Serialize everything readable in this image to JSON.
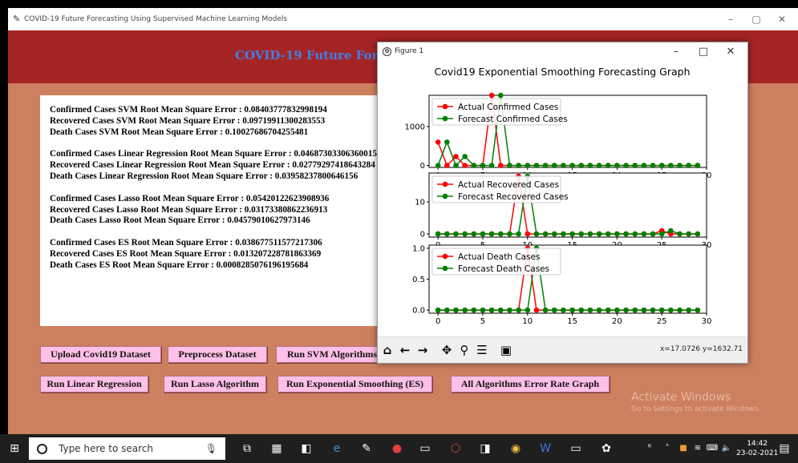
{
  "app": {
    "window_title": "COVID-19 Future Forecasting Using Supervised Machine Learning Models",
    "banner_title": "COVID-19 Future Forecasting Using Supervised Machine Learning Models",
    "window_controls": [
      "–",
      "▢",
      "✕"
    ]
  },
  "results": [
    [
      "Confirmed Cases SVM Root Mean Square Error : 0.08403777832998194",
      "Recovered Cases SVM Root Mean Square Error : 0.09719911300283553",
      "Death Cases SVM Root Mean Square Error : 0.10027686704255481"
    ],
    [
      "Confirmed Cases Linear Regression Root Mean Square Error : 0.04687303306360015",
      "Recovered Cases Linear Regression Root Mean Square Error : 0.02779297418643284",
      "Death Cases Linear Regression Root Mean Square Error : 0.03958237800646156"
    ],
    [
      "Confirmed Cases Lasso Root Mean Square Error : 0.05420122623908936",
      "Recovered Cases Lasso Root Mean Square Error : 0.03173380862236913",
      "Death Cases Lasso Root Mean Square Error : 0.04579010627973146"
    ],
    [
      "Confirmed Cases ES Root Mean Square Error : 0.038677511577217306",
      "Recovered Cases ES Root Mean Square Error : 0.013207228781863369",
      "Death Cases ES Root Mean Square Error : 0.0008285076196195684"
    ]
  ],
  "buttons": {
    "upload": "Upload Covid19 Dataset",
    "preprocess": "Preprocess Dataset",
    "svm": "Run SVM Algorithms",
    "linear": "Run Linear Regression",
    "lasso": "Run Lasso Algorithm",
    "es": "Run Exponential Smoothing (ES)",
    "error_graph": "All Algorithms Error Rate Graph"
  },
  "watermark": {
    "line1": "Activate Windows",
    "line2": "Go to Settings to activate Windows."
  },
  "figure": {
    "window_title": "Figure 1",
    "window_controls": [
      "–",
      "□",
      "✕"
    ],
    "coord_readout": "x=17.0726    y=1632.71",
    "toolbar_icons": [
      "home-icon",
      "back-icon",
      "forward-icon",
      "pan-icon",
      "zoom-icon",
      "subplots-icon",
      "save-icon"
    ]
  },
  "chart_data": {
    "type": "line",
    "title": "Covid19 Exponential Smoothing Forecasting Graph",
    "subplots": [
      {
        "legend": "top-left",
        "xlim": [
          -1,
          30
        ],
        "ylim": [
          -50,
          1800
        ],
        "xticks": [
          0,
          5,
          10,
          15,
          20,
          25,
          30
        ],
        "yticks": [
          0,
          1000
        ],
        "x": [
          0,
          1,
          2,
          3,
          4,
          5,
          6,
          7,
          8,
          9,
          10,
          11,
          12,
          13,
          14,
          15,
          16,
          17,
          18,
          19,
          20,
          21,
          22,
          23,
          24,
          25,
          26,
          27,
          28,
          29
        ],
        "series": [
          {
            "name": "Actual Confirmed Cases",
            "color": "#ff0000",
            "values": [
              600,
              0,
              230,
              0,
              0,
              0,
              1800,
              0,
              0,
              0,
              0,
              0,
              0,
              0,
              0,
              0,
              0,
              0,
              0,
              0,
              0,
              0,
              0,
              0,
              0,
              0,
              0,
              0,
              0,
              0
            ]
          },
          {
            "name": "Forecast Confirmed Cases",
            "color": "#008000",
            "values": [
              0,
              600,
              0,
              230,
              0,
              0,
              0,
              1800,
              0,
              0,
              0,
              0,
              0,
              0,
              0,
              0,
              0,
              0,
              0,
              0,
              0,
              0,
              0,
              0,
              0,
              0,
              0,
              0,
              0,
              0
            ]
          }
        ]
      },
      {
        "legend": "top-left",
        "xlim": [
          -1,
          30
        ],
        "ylim": [
          -1,
          19
        ],
        "xticks": [
          0,
          5,
          10,
          15,
          20,
          25,
          30
        ],
        "yticks": [
          0,
          10
        ],
        "x": [
          0,
          1,
          2,
          3,
          4,
          5,
          6,
          7,
          8,
          9,
          10,
          11,
          12,
          13,
          14,
          15,
          16,
          17,
          18,
          19,
          20,
          21,
          22,
          23,
          24,
          25,
          26,
          27,
          28,
          29
        ],
        "series": [
          {
            "name": "Actual Recovered Cases",
            "color": "#ff0000",
            "values": [
              0,
              0,
              0,
              0,
              0,
              0,
              0,
              0,
              0,
              18,
              0,
              0,
              0,
              0,
              0,
              0,
              0,
              0,
              0,
              0,
              0,
              0,
              0,
              0,
              0,
              1,
              0,
              0,
              0,
              0
            ]
          },
          {
            "name": "Forecast Recovered Cases",
            "color": "#008000",
            "values": [
              0,
              0,
              0,
              0,
              0,
              0,
              0,
              0,
              0,
              0,
              18,
              0,
              0,
              0,
              0,
              0,
              0,
              0,
              0,
              0,
              0,
              0,
              0,
              0,
              0,
              0,
              1,
              0,
              0,
              0
            ]
          }
        ]
      },
      {
        "legend": "top-left",
        "xlim": [
          -1,
          30
        ],
        "ylim": [
          -0.05,
          1.05
        ],
        "xticks": [
          0,
          5,
          10,
          15,
          20,
          25,
          30
        ],
        "yticks": [
          0.0,
          0.5,
          1.0
        ],
        "x": [
          0,
          1,
          2,
          3,
          4,
          5,
          6,
          7,
          8,
          9,
          10,
          11,
          12,
          13,
          14,
          15,
          16,
          17,
          18,
          19,
          20,
          21,
          22,
          23,
          24,
          25,
          26,
          27,
          28,
          29
        ],
        "series": [
          {
            "name": "Actual Death Cases",
            "color": "#ff0000",
            "values": [
              0,
              0,
              0,
              0,
              0,
              0,
              0,
              0,
              0,
              0,
              1,
              0,
              0,
              0,
              0,
              0,
              0,
              0,
              0,
              0,
              0,
              0,
              0,
              0,
              0,
              0,
              0,
              0,
              0,
              0
            ]
          },
          {
            "name": "Forecast Death Cases",
            "color": "#008000",
            "values": [
              0,
              0,
              0,
              0,
              0,
              0,
              0,
              0,
              0,
              0,
              0,
              1,
              0,
              0,
              0,
              0,
              0,
              0,
              0,
              0,
              0,
              0,
              0,
              0,
              0,
              0,
              0,
              0,
              0,
              0
            ]
          }
        ]
      }
    ]
  },
  "taskbar": {
    "search_placeholder": "Type here to search",
    "time": "14:42",
    "date": "23-02-2021"
  }
}
